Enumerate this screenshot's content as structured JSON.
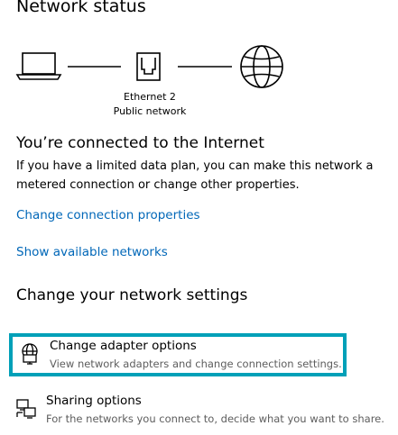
{
  "section_title": "Network status",
  "connection": {
    "adapter_name": "Ethernet 2",
    "network_type": "Public network"
  },
  "status": {
    "heading": "You’re connected to the Internet",
    "description": "If you have a limited data plan, you can make this network a metered connection or change other properties."
  },
  "links": {
    "change_connection_properties": "Change connection properties",
    "show_available_networks": "Show available networks"
  },
  "settings": {
    "heading": "Change your network settings",
    "options": [
      {
        "icon": "adapter-icon",
        "title": "Change adapter options",
        "description": "View network adapters and change connection settings."
      },
      {
        "icon": "sharing-icon",
        "title": "Sharing options",
        "description": "For the networks you connect to, decide what you want to share."
      }
    ]
  },
  "colors": {
    "link": "#0067b8",
    "highlight_border": "#00a0b8",
    "secondary_text": "#5d5d5d"
  }
}
